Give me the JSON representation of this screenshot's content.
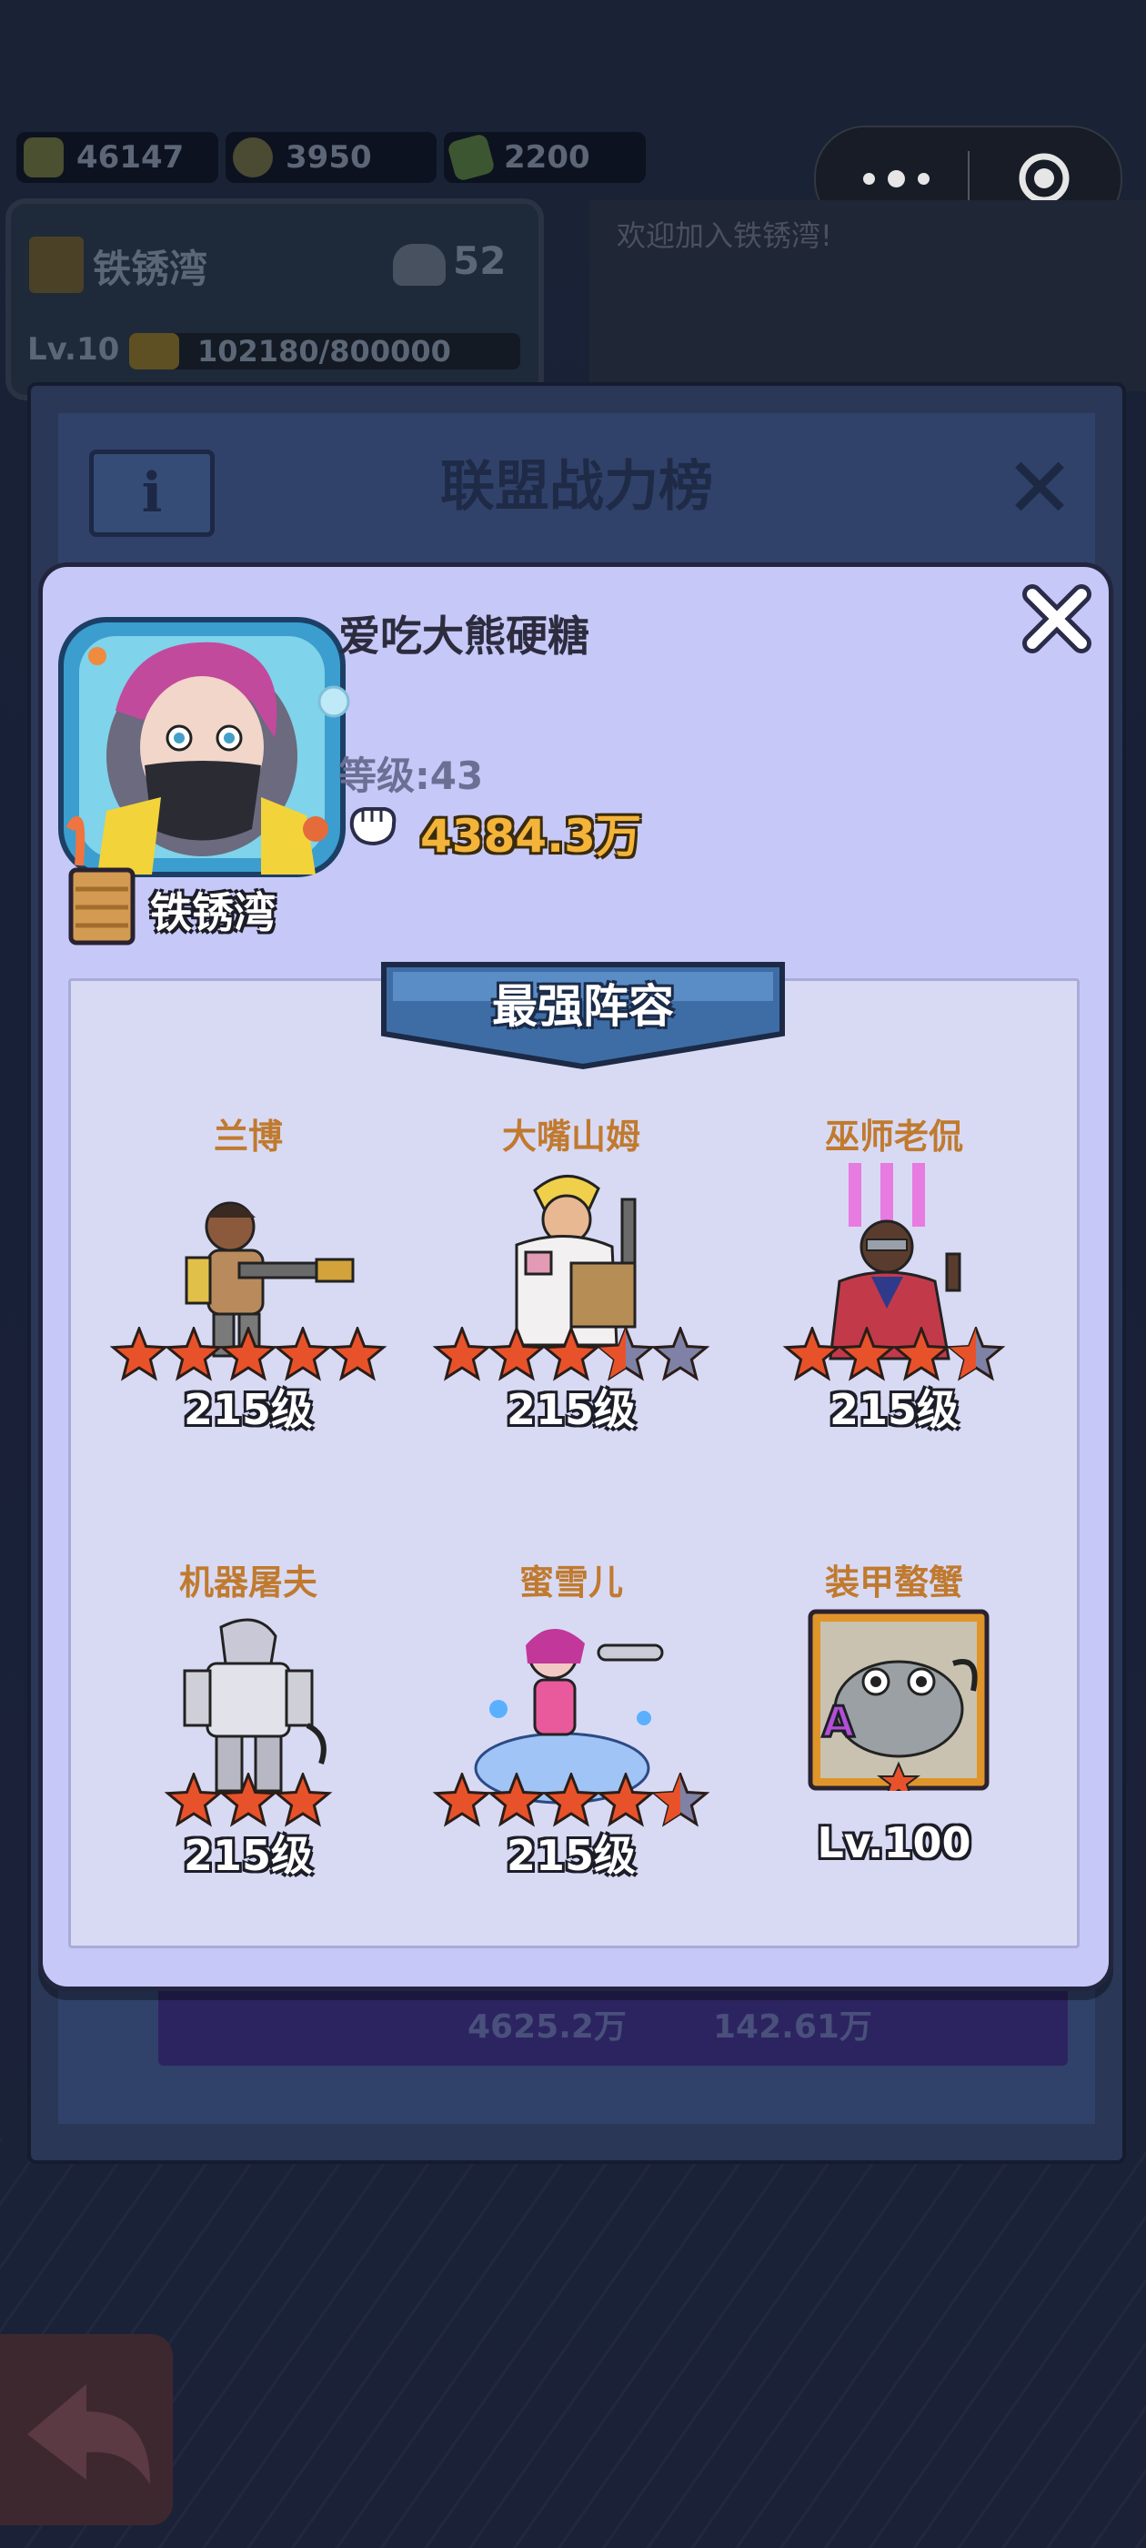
{
  "status_resources": [
    {
      "icon": "coin-icon",
      "value": "46147"
    },
    {
      "icon": "medal-icon",
      "value": "3950"
    },
    {
      "icon": "cash-icon",
      "value": "2200"
    }
  ],
  "alliance_card": {
    "name": "铁锈湾",
    "members": "52",
    "level": "Lv.10",
    "exp_text": "102180/800000",
    "exp_fraction": 0.128
  },
  "notice": "欢迎加入铁锈湾!",
  "rank_panel": {
    "title": "联盟战力榜",
    "info_label": "i",
    "footer_power": "4625.2万",
    "footer_money": "142.61万"
  },
  "player": {
    "name": "爱吃大熊硬糖",
    "level_label": "等级:43",
    "power": "4384.3万",
    "guild": "铁锈湾"
  },
  "lineup": {
    "title": "最强阵容",
    "heroes": [
      {
        "name": "兰博",
        "level": "215级",
        "stars": 5,
        "max_stars": 5
      },
      {
        "name": "大嘴山姆",
        "level": "215级",
        "stars": 3.5,
        "max_stars": 5
      },
      {
        "name": "巫师老侃",
        "level": "215级",
        "stars": 3.5,
        "max_stars": 4
      },
      {
        "name": "机器屠夫",
        "level": "215级",
        "stars": 3,
        "max_stars": 3
      },
      {
        "name": "蜜雪儿",
        "level": "215级",
        "stars": 4.5,
        "max_stars": 5
      }
    ],
    "pet": {
      "name": "装甲螯蟹",
      "level": "Lv.100",
      "rank_badge": "A"
    }
  },
  "colors": {
    "modal_bg": "#c6c8f8",
    "hero_name": "#c07a2f",
    "power_gold": "#f4b43a",
    "star_fill": "#e8522a"
  }
}
